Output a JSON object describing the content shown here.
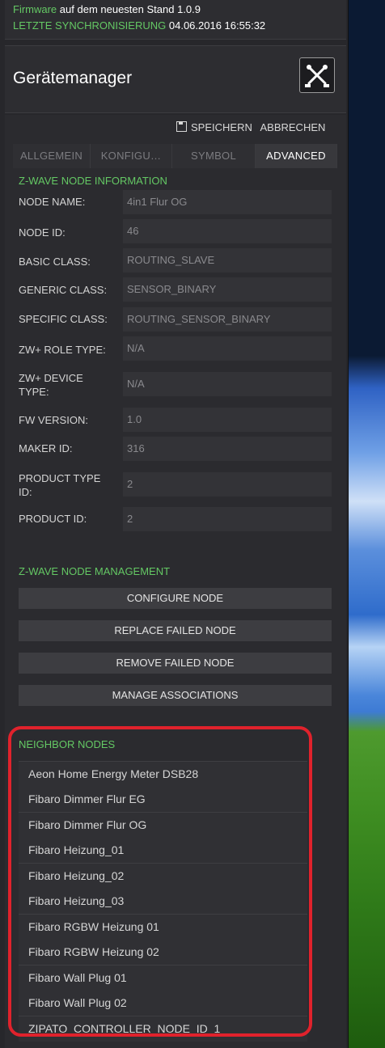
{
  "firmware": {
    "label": "Firmware",
    "text": "auf dem neuesten Stand 1.0.9",
    "sync_label": "LETZTE SYNCHRONISIERUNG",
    "sync_value": "04.06.2016 16:55:32"
  },
  "header": {
    "title": "Gerätemanager",
    "icon": "tools-icon"
  },
  "actions": {
    "save": "SPEICHERN",
    "cancel": "ABBRECHEN"
  },
  "tabs": [
    {
      "label": "ALLGEMEIN",
      "active": false
    },
    {
      "label": "KONFIGU…",
      "active": false
    },
    {
      "label": "SYMBOL",
      "active": false
    },
    {
      "label": "ADVANCED",
      "active": true
    }
  ],
  "node_info": {
    "title": "Z-WAVE NODE INFORMATION",
    "fields": [
      {
        "label": "NODE NAME:",
        "value": "4in1 Flur OG"
      },
      {
        "label": "NODE ID:",
        "value": "46"
      },
      {
        "label": "BASIC CLASS:",
        "value": "ROUTING_SLAVE"
      },
      {
        "label": "GENERIC CLASS:",
        "value": "SENSOR_BINARY"
      },
      {
        "label": "SPECIFIC CLASS:",
        "value": "ROUTING_SENSOR_BINARY"
      },
      {
        "label": "ZW+ ROLE TYPE:",
        "value": "N/A"
      },
      {
        "label": "ZW+ DEVICE TYPE:",
        "value": "N/A"
      },
      {
        "label": "FW VERSION:",
        "value": "1.0"
      },
      {
        "label": "MAKER ID:",
        "value": "316"
      },
      {
        "label": "PRODUCT TYPE ID:",
        "value": "2"
      },
      {
        "label": "PRODUCT ID:",
        "value": "2"
      }
    ]
  },
  "node_management": {
    "title": "Z-WAVE NODE MANAGEMENT",
    "buttons": [
      "CONFIGURE NODE",
      "REPLACE FAILED NODE",
      "REMOVE FAILED NODE",
      "MANAGE ASSOCIATIONS"
    ]
  },
  "neighbors": {
    "title": "NEIGHBOR NODES",
    "items": [
      "Aeon Home Energy Meter DSB28",
      "Fibaro Dimmer Flur EG",
      "Fibaro Dimmer Flur OG",
      "Fibaro Heizung_01",
      "Fibaro Heizung_02",
      "Fibaro Heizung_03",
      "Fibaro RGBW Heizung 01",
      "Fibaro RGBW Heizung 02",
      "Fibaro Wall Plug 01",
      "Fibaro Wall Plug 02",
      "ZIPATO_CONTROLLER_NODE_ID_1"
    ]
  },
  "colors": {
    "accent_green": "#64c864",
    "highlight_red": "#e0222c"
  }
}
